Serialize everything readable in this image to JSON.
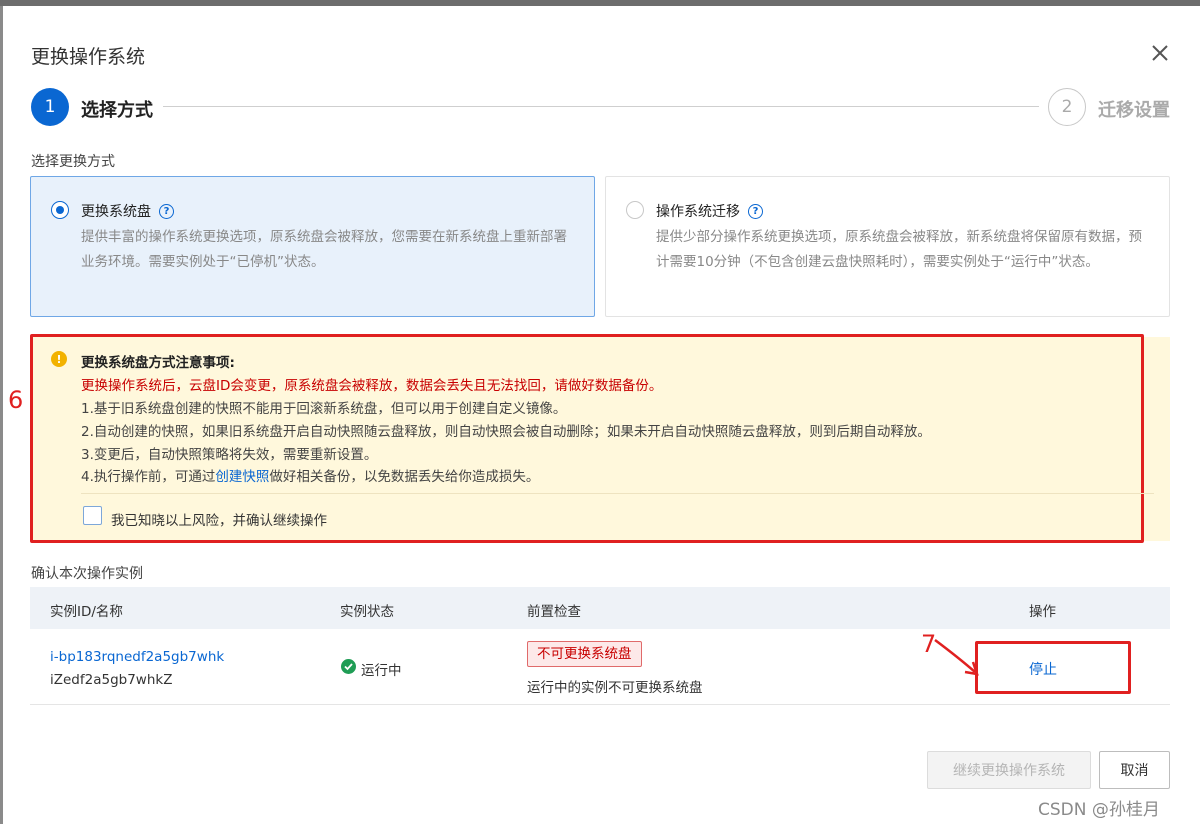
{
  "dialog": {
    "title": "更换操作系统",
    "close_icon": "close-icon"
  },
  "steps": [
    {
      "number": "1",
      "label": "选择方式",
      "active": true
    },
    {
      "number": "2",
      "label": "迁移设置",
      "active": false
    }
  ],
  "method": {
    "section_label": "选择更换方式",
    "options": [
      {
        "title": "更换系统盘",
        "selected": true,
        "description": "提供丰富的操作系统更换选项，原系统盘会被释放，您需要在新系统盘上重新部署业务环境。需要实例处于“已停机”状态。"
      },
      {
        "title": "操作系统迁移",
        "selected": false,
        "description": "提供少部分操作系统更换选项，原系统盘会被释放，新系统盘将保留原有数据，预计需要10分钟（不包含创建云盘快照耗时），需要实例处于“运行中”状态。"
      }
    ]
  },
  "warning": {
    "title": "更换系统盘方式注意事项:",
    "red_text": "更换操作系统后，云盘ID会变更，原系统盘会被释放，数据会丢失且无法找回，请做好数据备份。",
    "line1": "1.基于旧系统盘创建的快照不能用于回滚新系统盘，但可以用于创建自定义镜像。",
    "line2": "2.自动创建的快照，如果旧系统盘开启自动快照随云盘释放，则自动快照会被自动删除；如果未开启自动快照随云盘释放，则到后期自动释放。",
    "line3": "3.变更后，自动快照策略将失效，需要重新设置。",
    "line4_pre": "4.执行操作前，可通过",
    "line4_link": "创建快照",
    "line4_post": "做好相关备份，以免数据丢失给你造成损失。",
    "checkbox_label": "我已知晓以上风险，并确认继续操作",
    "checkbox_checked": false
  },
  "instances": {
    "section_label": "确认本次操作实例",
    "columns": [
      "实例ID/名称",
      "实例状态",
      "前置检查",
      "操作"
    ],
    "rows": [
      {
        "id": "i-bp183rqnedf2a5gb7whk",
        "name": "iZedf2a5gb7whkZ",
        "status": "运行中",
        "precheck_badge": "不可更换系统盘",
        "precheck_text": "运行中的实例不可更换系统盘",
        "action": "停止"
      }
    ]
  },
  "annotations": {
    "box6": "6",
    "box7": "7"
  },
  "footer": {
    "continue_label": "继续更换操作系统",
    "cancel_label": "取消"
  },
  "watermark": "CSDN @孙桂月",
  "colors": {
    "primary": "#0a67d2",
    "danger": "#c80000",
    "warning_bg": "#fff8dc",
    "success": "#1f9d55",
    "annotation_red": "#e02020"
  }
}
